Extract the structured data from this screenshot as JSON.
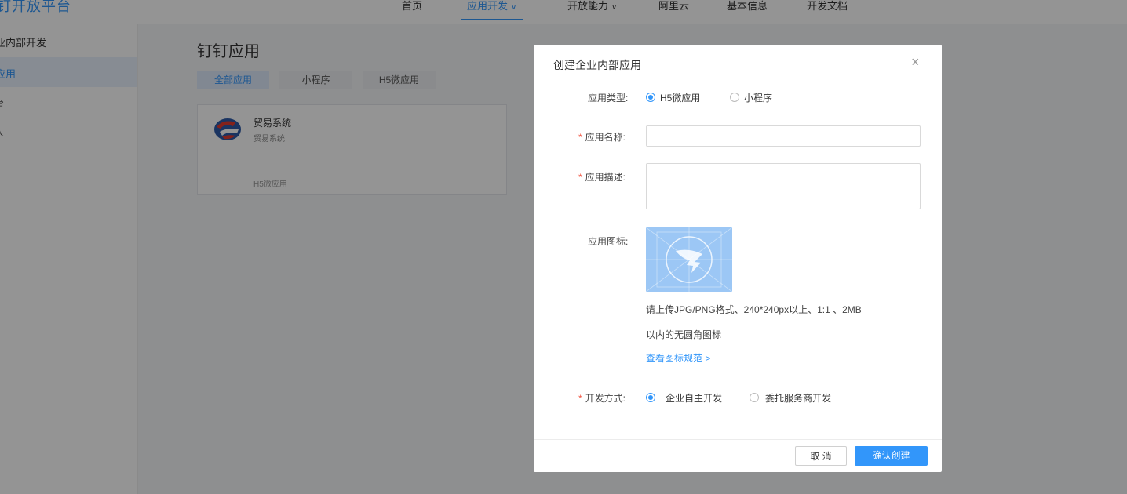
{
  "header": {
    "brand": "钉开放平台",
    "nav": [
      {
        "label": "首页"
      },
      {
        "label": "应用开发",
        "chevron": "∨"
      },
      {
        "label": "开放能力",
        "chevron": "∨"
      },
      {
        "label": "阿里云"
      },
      {
        "label": "基本信息"
      },
      {
        "label": "开发文档"
      }
    ]
  },
  "sidebar": {
    "items": [
      {
        "label": "业内部开发"
      },
      {
        "label": "应用"
      },
      {
        "label": "台"
      },
      {
        "label": "人"
      }
    ]
  },
  "main": {
    "title": "钉钉应用",
    "filters": [
      {
        "label": "全部应用"
      },
      {
        "label": "小程序"
      },
      {
        "label": "H5微应用"
      }
    ],
    "app": {
      "name": "贸易系统",
      "description": "贸易系统",
      "type": "H5微应用"
    }
  },
  "modal": {
    "title": "创建企业内部应用",
    "close": "×",
    "app_type_label": "应用类型:",
    "app_type_options": [
      "H5微应用",
      "小程序"
    ],
    "required_mark": "*",
    "name_label": "应用名称:",
    "name_value": "",
    "desc_label": "应用描述:",
    "desc_value": "",
    "icon_label": "应用图标:",
    "icon_hint_line1": "请上传JPG/PNG格式、240*240px以上、1:1 、2MB",
    "icon_hint_line2": "以内的无圆角图标",
    "icon_spec_link": "查看图标规范 >",
    "dev_mode_label": "开发方式:",
    "dev_mode_options": [
      "企业自主开发",
      "委托服务商开发"
    ],
    "cancel": "取 消",
    "confirm": "确认创建"
  },
  "colors": {
    "accent": "#3296fa",
    "required": "#f25643",
    "icon_placeholder": "#9cc7f5"
  }
}
